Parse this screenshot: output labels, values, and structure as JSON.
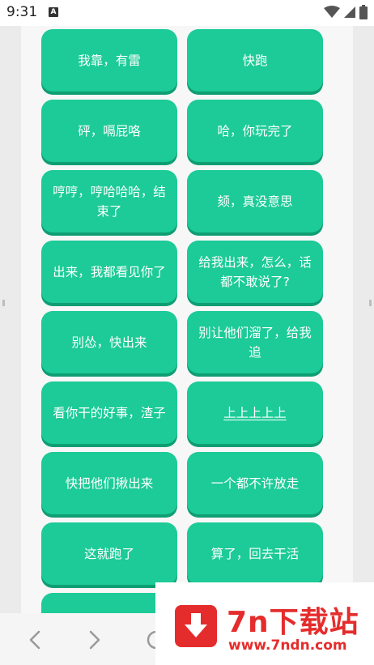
{
  "status_bar": {
    "time": "9:31",
    "notification_glyph": "A",
    "icons": [
      "wifi-icon",
      "signal-icon",
      "battery-icon"
    ]
  },
  "buttons": [
    {
      "label": "我靠，有雷"
    },
    {
      "label": "快跑"
    },
    {
      "label": "砰，嗝屁咯"
    },
    {
      "label": "哈，你玩完了"
    },
    {
      "label": "哼哼，哼哈哈哈，结束了"
    },
    {
      "label": "颏，真没意思"
    },
    {
      "label": "出来，我都看见你了"
    },
    {
      "label": "给我出来，怎么，话都不敢说了?"
    },
    {
      "label": "别怂，快出来"
    },
    {
      "label": "别让他们溜了，给我追"
    },
    {
      "label": "看你干的好事，渣子"
    },
    {
      "label": "上上上上上"
    },
    {
      "label": "快把他们揪出来"
    },
    {
      "label": "一个都不许放走"
    },
    {
      "label": "这就跑了"
    },
    {
      "label": "算了，回去干活"
    }
  ],
  "nav_bar": {
    "icons": [
      "back-arrow-icon",
      "forward-arrow-icon",
      "home-circle-icon"
    ]
  },
  "watermark": {
    "title": "7n下载站",
    "url": "www.7ndn.com",
    "accent": "#e52c2c"
  },
  "colors": {
    "button": "#1ccb97",
    "button_shadow": "#0f9e73"
  }
}
